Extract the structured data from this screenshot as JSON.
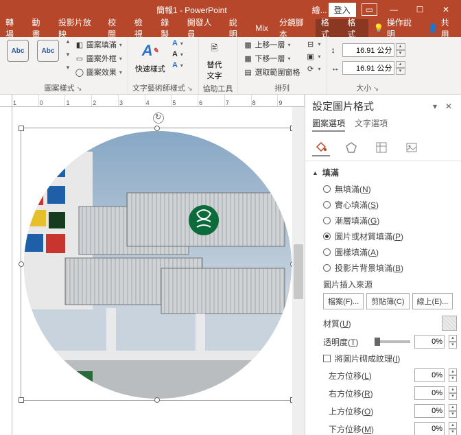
{
  "titlebar": {
    "title": "簡報1 - PowerPoint",
    "drawing": "繪...",
    "signin": "登入"
  },
  "tabs": {
    "items": [
      "轉場",
      "動畫",
      "投影片放映",
      "校閱",
      "檢視",
      "錄製",
      "開發人員",
      "說明",
      "Mix",
      "分鏡腳本"
    ],
    "format1": "格式",
    "format2": "格式",
    "tellme": "操作說明",
    "share": "共用"
  },
  "ribbon": {
    "styles": {
      "abc1": "Abc",
      "abc2": "Abc",
      "fill": "圖案填滿",
      "outline": "圖案外框",
      "effects": "圖案效果",
      "label": "圖案樣式"
    },
    "wordart": {
      "quick": "快速樣式",
      "label": "文字藝術師樣式"
    },
    "alt": {
      "text": "替代\n文字",
      "label": "協助工具"
    },
    "arrange": {
      "forward": "上移一層",
      "backward": "下移一層",
      "selpane": "選取範圍窗格",
      "label": "排列"
    },
    "size": {
      "height": "16.91 公分",
      "width": "16.91 公分",
      "label": "大小"
    }
  },
  "ruler_marks": [
    "1",
    "0",
    "1",
    "2",
    "3",
    "4",
    "5",
    "6",
    "7",
    "8",
    "9"
  ],
  "panel": {
    "title": "設定圖片格式",
    "tab_shape": "圖案選項",
    "tab_text": "文字選項",
    "section_fill": "填滿",
    "fill_options": {
      "none": "無填滿(N)",
      "solid": "實心填滿(S)",
      "gradient": "漸層填滿(G)",
      "picture": "圖片或材質填滿(P)",
      "pattern": "圖樣填滿(A)",
      "slidebg": "投影片背景填滿(B)"
    },
    "insert_from": "圖片插入來源",
    "btn_file": "檔案(F)...",
    "btn_clipboard": "剪貼簿(C)",
    "btn_online": "線上(E)...",
    "texture_label": "材質(U)",
    "transparency": "透明度(T)",
    "transparency_val": "0%",
    "tile": "將圖片砌成紋理(I)",
    "offset_left": "左方位移(L)",
    "offset_right": "右方位移(R)",
    "offset_top": "上方位移(O)",
    "offset_bottom": "下方位移(M)",
    "offset_val": "0%"
  }
}
